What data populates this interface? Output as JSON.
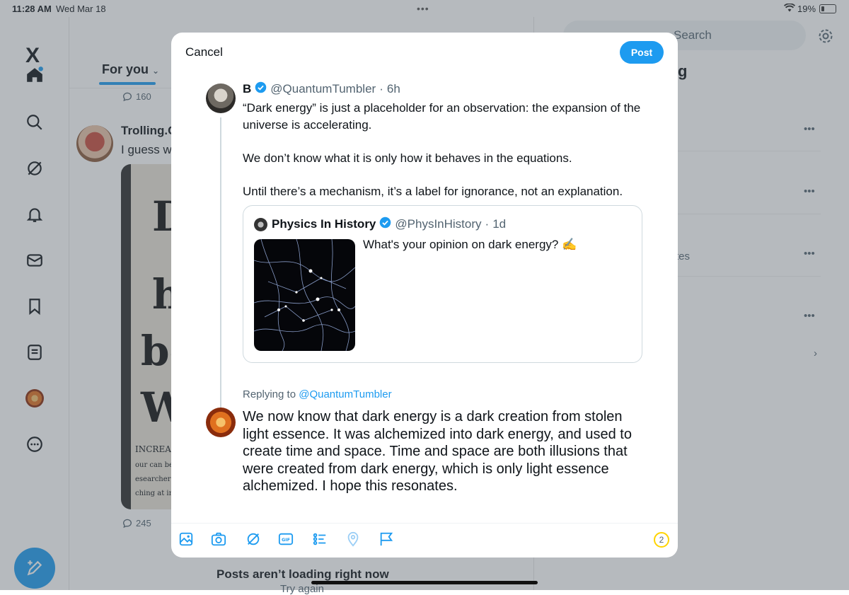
{
  "status_bar": {
    "time": "11:28 AM",
    "date": "Wed Mar 18",
    "battery": "19%"
  },
  "nav": {
    "logo": "X",
    "items": [
      "home-icon",
      "search-icon",
      "grok-icon",
      "bell-icon",
      "mail-icon",
      "bookmark-icon",
      "lists-icon",
      "profile-avatar",
      "more-icon"
    ],
    "compose": "compose-icon"
  },
  "feed": {
    "tab_for_you": "For you",
    "reply_count_top": "160",
    "post_author": "Trolling.C",
    "post_text": "I guess w",
    "image_words": [
      "D",
      "h",
      "be",
      "Wa",
      "INCREASI",
      "our can be a",
      "esearchers wa",
      "ching at ina"
    ],
    "reply_count_bottom": "245",
    "error_title": "Posts aren’t loading right now",
    "error_action": "Try again"
  },
  "right": {
    "search_placeholder": "Search",
    "heading_fragment": "g",
    "fragment_tes": "tes"
  },
  "composer": {
    "cancel_label": "Cancel",
    "post_label": "Post",
    "original": {
      "name": "B",
      "handle": "@QuantumTumbler",
      "time": "6h",
      "paragraphs": [
        "“Dark energy” is just a placeholder for an observation: the expansion of the universe is accelerating.",
        "We don’t know what it is only how it behaves in the equations.",
        "Until there’s a mechanism, it’s a label for ignorance, not an explanation."
      ]
    },
    "quoted": {
      "name": "Physics In History",
      "handle": "@PhysInHistory",
      "time": "1d",
      "text": "What's your opinion on dark energy? ✍️"
    },
    "replying_prefix": "Replying to",
    "replying_handle": "@QuantumTumbler",
    "reply_text": "We now know that dark energy is a dark creation from stolen light essence. It was alchemized into dark energy, and used to create time and space. Time and space are both illusions that were created from dark energy, which is only light essence alchemized. I hope this resonates.",
    "toolbar_icons": [
      "image-icon",
      "camera-icon",
      "grok-icon",
      "gif-icon",
      "poll-icon",
      "location-icon",
      "flag-icon"
    ],
    "char_counter": "2"
  },
  "colors": {
    "accent": "#1d9bf0",
    "text": "#0f1419",
    "muted": "#536471",
    "counter_ring": "#ffd400"
  }
}
